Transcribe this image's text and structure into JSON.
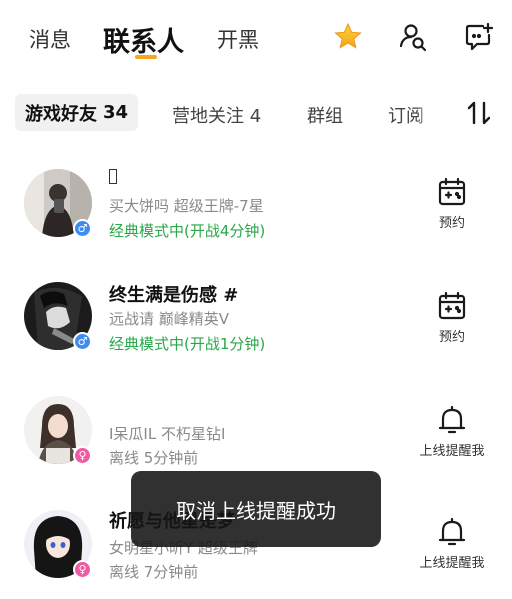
{
  "top_nav": {
    "tabs": [
      {
        "label": "消息",
        "active": false
      },
      {
        "label": "联系人",
        "active": true
      },
      {
        "label": "开黑",
        "active": false
      }
    ],
    "icons": [
      "star-icon",
      "user-search-icon",
      "add-chat-icon"
    ],
    "accent_color": "#f5a623"
  },
  "sub_tabs": {
    "active": {
      "label": "游戏好友",
      "count": "34"
    },
    "items": [
      {
        "label": "营地关注 4"
      },
      {
        "label": "群组"
      },
      {
        "label": "订阅"
      }
    ],
    "sort_icon": "sort-icon"
  },
  "contacts": [
    {
      "name": "",
      "subtitle": "买大饼吗   超级王牌-7星",
      "status": "经典模式中(开战4分钟)",
      "gender": "male",
      "gender_symbol": "♂",
      "action_label": "预约",
      "action_icon": "calendar-game-icon"
    },
    {
      "name": "终生满是伤感 #",
      "subtitle": "远战请   巅峰精英V",
      "status": "经典模式中(开战1分钟)",
      "gender": "male",
      "gender_symbol": "♂",
      "action_label": "预约",
      "action_icon": "calendar-game-icon"
    },
    {
      "name": "",
      "subtitle": "I呆瓜IL   不朽星钻I",
      "status": "离线  5分钟前",
      "gender": "female",
      "gender_symbol": "♀",
      "action_label": "上线提醒我",
      "action_icon": "bell-icon"
    },
    {
      "name": "祈愿与他星是梦",
      "subtitle": "女明星小昕Y   超级王牌",
      "status": "离线  7分钟前",
      "gender": "female",
      "gender_symbol": "♀",
      "action_label": "上线提醒我",
      "action_icon": "bell-icon"
    }
  ],
  "toast": {
    "message": "取消上线提醒成功"
  },
  "colors": {
    "online_status": "#2aa84a",
    "male_badge": "#3f8cf0",
    "female_badge": "#f05aa4"
  }
}
